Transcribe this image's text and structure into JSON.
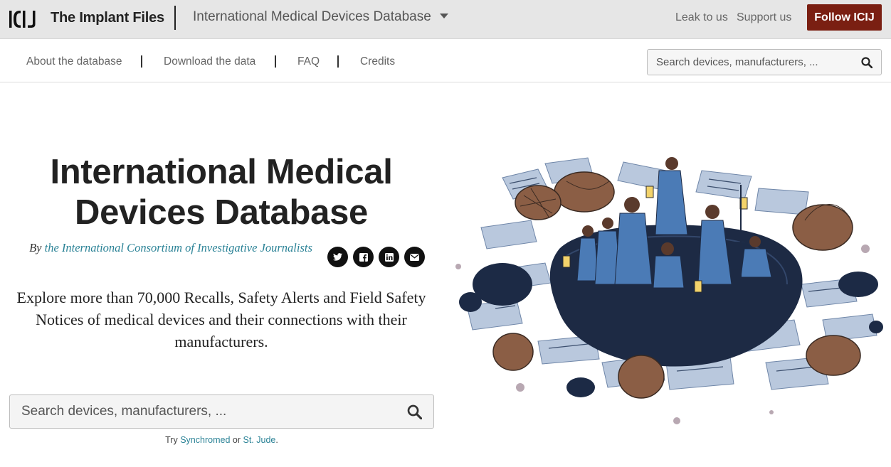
{
  "header": {
    "logo_text": "ICIJ",
    "brand": "The Implant Files",
    "project": "International Medical Devices Database",
    "links": [
      "Leak to us",
      "Support us"
    ],
    "follow_button": "Follow ICIJ",
    "follow_color": "#7a1f12"
  },
  "subnav": {
    "items": [
      "About the database",
      "Download the data",
      "FAQ",
      "Credits"
    ],
    "search_placeholder": "Search devices, manufacturers, ..."
  },
  "hero": {
    "title_line1": "International Medical",
    "title_line2": "Devices Database",
    "by": "By",
    "author": "the International Consortium of Investigative Journalists",
    "share_icons": [
      "twitter-icon",
      "facebook-icon",
      "linkedin-icon",
      "email-icon"
    ],
    "intro": "Explore more than 70,000 Recalls, Safety Alerts and Field Safety Notices of medical devices and their connections with their manufacturers.",
    "search_placeholder": "Search devices, manufacturers, ...",
    "try_prefix": "Try",
    "try_link1": "Synchromed",
    "try_or": "or",
    "try_link2": "St. Jude",
    "try_suffix": "."
  },
  "accent_link_color": "#2a8296"
}
